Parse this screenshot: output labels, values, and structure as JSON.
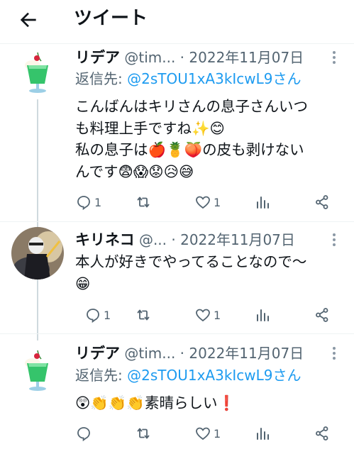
{
  "header": {
    "title": "ツイート",
    "back_icon": "back-arrow-icon"
  },
  "tweets": [
    {
      "name": "リデア",
      "handle": "@tim...",
      "dot": "·",
      "date": "2022年11月07日",
      "reply_prefix": "返信先: ",
      "reply_handle": "@2sTOU1xA3kIcwL9さん",
      "lines": [
        "こんばんはキリさんの息子さんいつ",
        "も料理上手ですね✨😊",
        "私の息子は🍎🍍🍑の皮も剥けない",
        "んです😨😱😟😥😅"
      ],
      "replies": "1",
      "likes": "1",
      "avatar": "melon-soda-avatar"
    },
    {
      "name": "キリネコ",
      "handle": "@...",
      "dot": "·",
      "date": "2022年11月07日",
      "lines": [
        "本人が好きでやってることなので〜",
        "😁"
      ],
      "replies": "1",
      "likes": "1",
      "avatar": "character-avatar"
    },
    {
      "name": "リデア",
      "handle": "@tim...",
      "dot": "·",
      "date": "2022年11月07日",
      "reply_prefix": "返信先: ",
      "reply_handle": "@2sTOU1xA3kIcwL9さん",
      "lines": [
        "😲👏👏👏素晴らしい❗"
      ],
      "replies": "",
      "likes": "1",
      "avatar": "melon-soda-avatar"
    }
  ],
  "colors": {
    "link": "#1d9bf0",
    "muted": "#536471",
    "text": "#0f1419",
    "divider": "#eff3f4"
  }
}
